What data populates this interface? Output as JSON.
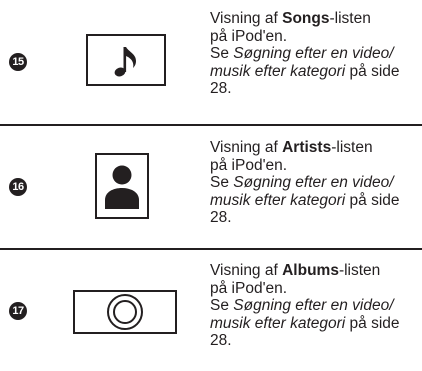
{
  "rows": [
    {
      "number": "15",
      "icon": "music-note-icon",
      "line1_prefix": "Visning af ",
      "line1_bold": "Songs",
      "line1_suffix": "-listen",
      "line2": "på iPod'en.",
      "see_prefix": "Se ",
      "see_italic": "Søgning efter en video/ musik efter kategori",
      "see_suffix": " på side 28."
    },
    {
      "number": "16",
      "icon": "person-icon",
      "line1_prefix": "Visning af ",
      "line1_bold": "Artists",
      "line1_suffix": "-listen",
      "line2": "på iPod'en.",
      "see_prefix": "Se ",
      "see_italic": "Søgning efter en video/ musik efter kategori",
      "see_suffix": " på side 28."
    },
    {
      "number": "17",
      "icon": "album-disc-icon",
      "line1_prefix": "Visning af ",
      "line1_bold": "Albums",
      "line1_suffix": "-listen",
      "line2": "på iPod'en.",
      "see_prefix": "Se ",
      "see_italic": "Søgning efter en video/ musik efter kategori",
      "see_suffix": " på side 28."
    }
  ]
}
